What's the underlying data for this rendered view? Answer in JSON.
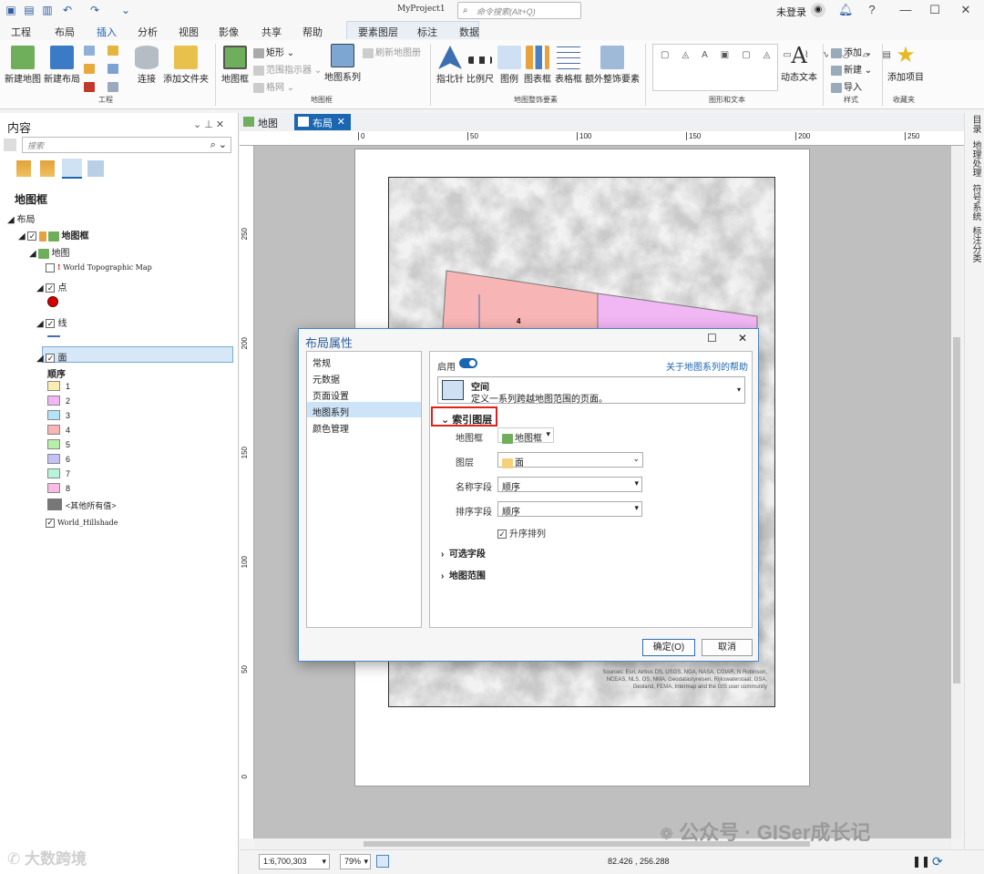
{
  "titlebar": {
    "project": "MyProject1",
    "search_placeholder": "命令搜索(Alt+Q)",
    "user": "未登录",
    "help": "?",
    "minimize": "—",
    "maximize": "☐",
    "close": "✕"
  },
  "menu_tabs": [
    "工程",
    "布局",
    "插入",
    "分析",
    "视图",
    "影像",
    "共享",
    "帮助",
    "要素图层",
    "标注",
    "数据"
  ],
  "ribbon": {
    "project_group": {
      "label": "工程",
      "new_map": "新建地图",
      "new_layout": "新建布局",
      "connect": "连接",
      "add_folder": "添加文件夹"
    },
    "mapframe_group": {
      "label": "地图框",
      "map_frame": "地图框",
      "rectangle": "矩形",
      "extent_indicator": "范围指示器",
      "grid": "格网",
      "refresh": "刷新地图册",
      "map_series": "地图系列"
    },
    "surround_group": {
      "label": "地图整饰要素",
      "north_arrow": "指北针",
      "scale_bar": "比例尺",
      "legend": "图例",
      "chart_frame": "图表框",
      "table_frame": "表格框",
      "extra": "额外整饰要素"
    },
    "graphics_group": {
      "label": "图形和文本",
      "dynamic_text": "动态文本"
    },
    "style_group": {
      "label": "样式",
      "add": "添加",
      "new": "新建",
      "import": "导入"
    },
    "favorites_group": {
      "label": "收藏夹",
      "add_item": "添加项目"
    }
  },
  "contents": {
    "title": "内容",
    "search_placeholder": "搜索",
    "section": "地图框",
    "tree": {
      "layout": "布局",
      "map_frame": "地图框",
      "map": "地图",
      "topo": "World Topographic Map",
      "point": "点",
      "line": "线",
      "polygon": "面",
      "field": "顺序",
      "other": "<其他所有值>",
      "hillshade": "World_Hillshade"
    },
    "swatches": [
      {
        "label": "1",
        "color": "#fbeeb0"
      },
      {
        "label": "2",
        "color": "#f1b6f4"
      },
      {
        "label": "3",
        "color": "#b4e3f8"
      },
      {
        "label": "4",
        "color": "#f7b5b5"
      },
      {
        "label": "5",
        "color": "#b6f0a8"
      },
      {
        "label": "6",
        "color": "#c4c1f6"
      },
      {
        "label": "7",
        "color": "#b8f4da"
      },
      {
        "label": "8",
        "color": "#f8bce4"
      }
    ]
  },
  "doc_tabs": [
    "地图",
    "布局"
  ],
  "hruler_ticks": [
    "0",
    "50",
    "100",
    "150",
    "200",
    "250"
  ],
  "vruler_ticks": [
    "250",
    "200",
    "150",
    "100",
    "50",
    "0"
  ],
  "map": {
    "label": "4",
    "credits": "Sources: Esri, Airbus DS, USGS, NGA, NASA, CGIAR, N Robinson, NCEAS, NLS, OS, NMA, Geodatastyrelsen, Rijkswaterstaat, GSA, Geoland, FEMA, Intermap and the GIS user community"
  },
  "right_tabs": [
    "目录",
    "地理处理",
    "符号系统",
    "标注分类"
  ],
  "status": {
    "scale": "1:6,700,303",
    "zoom": "79%",
    "coords": "82.426 , 256.288"
  },
  "dialog": {
    "title": "布局属性",
    "maximize": "☐",
    "close": "✕",
    "nav": [
      "常规",
      "元数据",
      "页面设置",
      "地图系列",
      "颜色管理"
    ],
    "enable_label": "启用",
    "help_link": "关于地图系列的帮助",
    "type_title": "空间",
    "type_desc": "定义一系列跨越地图范围的页面。",
    "index_section": "索引图层",
    "fields": [
      {
        "label": "地图框",
        "value": "地图框"
      },
      {
        "label": "图层",
        "value": "面"
      },
      {
        "label": "名称字段",
        "value": "顺序"
      },
      {
        "label": "排序字段",
        "value": "顺序"
      }
    ],
    "ascending": "升序排列",
    "optional_fields": "可选字段",
    "map_extent": "地图范围",
    "ok": "确定(O)",
    "cancel": "取消"
  },
  "watermark": {
    "right": "公众号 · GISer成长记",
    "left": "大数跨境"
  }
}
